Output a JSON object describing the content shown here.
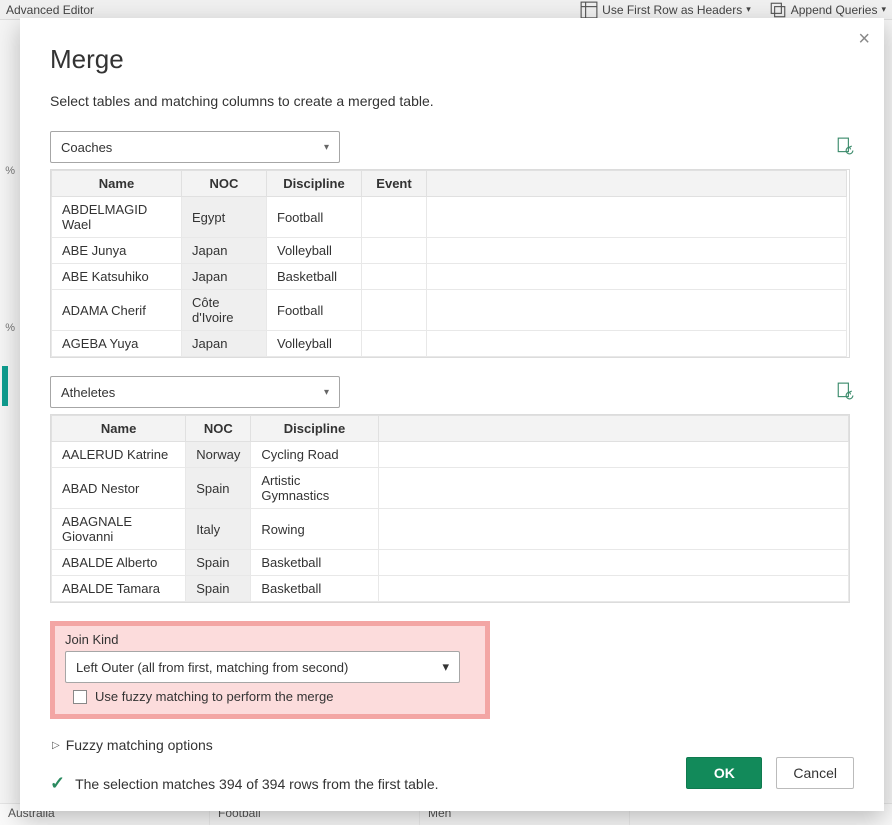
{
  "background": {
    "toolbar_left": "Advanced Editor",
    "toolbar_items": [
      "Use First Row as Headers",
      "Append Queries"
    ],
    "left_pct": "%",
    "bottom_cells": [
      "Australia",
      "Football",
      "Men"
    ]
  },
  "dialog": {
    "title": "Merge",
    "subtitle": "Select tables and matching columns to create a merged table.",
    "close_tooltip": "Close",
    "table1": {
      "dropdown_value": "Coaches",
      "headers": [
        "Name",
        "NOC",
        "Discipline",
        "Event"
      ],
      "rows": [
        {
          "name": "ABDELMAGID Wael",
          "noc": "Egypt",
          "discipline": "Football",
          "event": ""
        },
        {
          "name": "ABE Junya",
          "noc": "Japan",
          "discipline": "Volleyball",
          "event": ""
        },
        {
          "name": "ABE Katsuhiko",
          "noc": "Japan",
          "discipline": "Basketball",
          "event": ""
        },
        {
          "name": "ADAMA Cherif",
          "noc": "Côte d'Ivoire",
          "discipline": "Football",
          "event": ""
        },
        {
          "name": "AGEBA Yuya",
          "noc": "Japan",
          "discipline": "Volleyball",
          "event": ""
        }
      ]
    },
    "table2": {
      "dropdown_value": "Atheletes",
      "headers": [
        "Name",
        "NOC",
        "Discipline"
      ],
      "rows": [
        {
          "name": "AALERUD Katrine",
          "noc": "Norway",
          "discipline": "Cycling Road"
        },
        {
          "name": "ABAD Nestor",
          "noc": "Spain",
          "discipline": "Artistic Gymnastics"
        },
        {
          "name": "ABAGNALE Giovanni",
          "noc": "Italy",
          "discipline": "Rowing"
        },
        {
          "name": "ABALDE Alberto",
          "noc": "Spain",
          "discipline": "Basketball"
        },
        {
          "name": "ABALDE Tamara",
          "noc": "Spain",
          "discipline": "Basketball"
        }
      ]
    },
    "join": {
      "label": "Join Kind",
      "value": "Left Outer (all from first, matching from second)"
    },
    "fuzzy_checkbox_label": "Use fuzzy matching to perform the merge",
    "fuzzy_options_label": "Fuzzy matching options",
    "status_text": "The selection matches 394 of 394 rows from the first table.",
    "buttons": {
      "ok": "OK",
      "cancel": "Cancel"
    }
  }
}
